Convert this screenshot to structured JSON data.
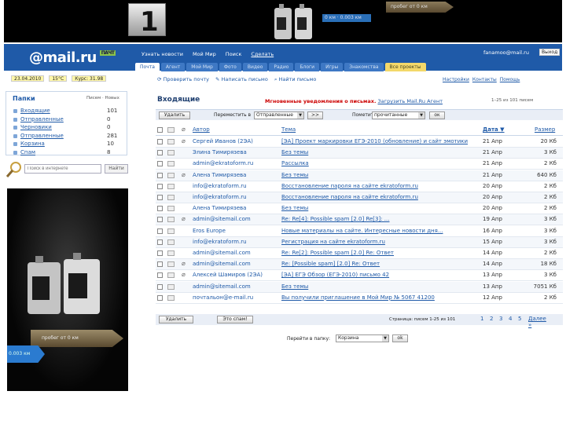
{
  "banner": {
    "badge_number": "1",
    "progress_short": "0 км · 0.003 км",
    "progress_long": "пробег от 0 км"
  },
  "header": {
    "logo": "@mail.ru",
    "logo_badge": "ПАЧТ",
    "nav": [
      "Узнать новости",
      "Мой Мир",
      "Поиск",
      "Сделать"
    ],
    "account": "fanamoo@mail.ru",
    "exit": "Выход"
  },
  "tabs": [
    "Почта",
    "Агент",
    "Мой Мир",
    "Фото",
    "Видео",
    "Радио",
    "Блоги",
    "Игры",
    "Знакомства",
    "Все проекты"
  ],
  "left": {
    "date_strip": [
      "23.04.2010",
      "15°C",
      "Курс: 31.98"
    ],
    "folders_title": "Папки",
    "folders_head": "Писем · Новых",
    "folders": [
      {
        "name": "Входящие",
        "count": "101"
      },
      {
        "name": "Отправленные",
        "count": "0"
      },
      {
        "name": "Черновики",
        "count": "0"
      },
      {
        "name": "Отправленные",
        "count": "281"
      },
      {
        "name": "Корзина",
        "count": "10"
      },
      {
        "name": "Спам",
        "count": "8"
      }
    ],
    "search_placeholder": "Поиск в интернете",
    "search_button": "Найти",
    "ad_bar1": "пробег от 0 км",
    "ad_bar2": "0.003 км"
  },
  "actions": {
    "check": "Проверить почту",
    "compose": "Написать письмо",
    "find": "Найти письмо"
  },
  "right_links": [
    "Настройки",
    "Контакты",
    "Помощь"
  ],
  "inbox_title": "Входящие",
  "im_notice": {
    "red": "Мгновенные уведомления о письмах.",
    "link": "Загрузить Mail.Ru Агент"
  },
  "top_right_small": "1–25 из 101 писем",
  "filters": {
    "delete": "Удалить",
    "move_to_label": "Переместить в",
    "move_select": "Отправленные",
    "go": ">>",
    "mark_label": "Пометить",
    "mark_select": "прочитанные",
    "ok": "ок"
  },
  "columns": {
    "author": "Автор",
    "subject": "Тема",
    "date": "Дата ▼",
    "size": "Размер"
  },
  "messages": [
    {
      "author": "Сергей Иванов (2ЭА)",
      "subject": "[ЭА] Проект маркировки ЕГЭ-2010 (обновление) и сайт эмотики",
      "date": "21 Апр",
      "size": "20 Кб",
      "clip": true
    },
    {
      "author": "Элина Тимирязева",
      "subject": "Без темы",
      "date": "21 Апр",
      "size": "3 Кб",
      "clip": false
    },
    {
      "author": "admin@ekratoform.ru",
      "subject": "Рассылка",
      "date": "21 Апр",
      "size": "2 Кб",
      "clip": false
    },
    {
      "author": "Алена Тимирязева",
      "subject": "Без темы",
      "date": "21 Апр",
      "size": "640 Кб",
      "clip": true
    },
    {
      "author": "info@ekratoform.ru",
      "subject": "Восстановление пароля на сайте ekratoform.ru",
      "date": "20 Апр",
      "size": "2 Кб",
      "clip": false
    },
    {
      "author": "info@ekratoform.ru",
      "subject": "Восстановление пароля на сайте ekratoform.ru",
      "date": "20 Апр",
      "size": "2 Кб",
      "clip": false
    },
    {
      "author": "Алена Тимирязева",
      "subject": "Без темы",
      "date": "20 Апр",
      "size": "2 Кб",
      "clip": false
    },
    {
      "author": "admin@sitemail.com",
      "subject": "Re: Re[4]: Possible spam [2.0] Re[3]: ...",
      "date": "19 Апр",
      "size": "3 Кб",
      "clip": true
    },
    {
      "author": "Eros Europe",
      "subject": "Новые материалы на сайте. Интересные новости дня...",
      "date": "16 Апр",
      "size": "3 Кб",
      "clip": false
    },
    {
      "author": "info@ekratoform.ru",
      "subject": "Регистрация на сайте ekratoform.ru",
      "date": "15 Апр",
      "size": "3 Кб",
      "clip": false
    },
    {
      "author": "admin@sitemail.com",
      "subject": "Re: Re[2]: Possible spam [2.0] Re: Ответ",
      "date": "14 Апр",
      "size": "2 Кб",
      "clip": false
    },
    {
      "author": "admin@sitemail.com",
      "subject": "Re: [Possible spam] [2.0] Re: Ответ",
      "date": "14 Апр",
      "size": "18 Кб",
      "clip": true
    },
    {
      "author": "Алексей Шамиров (2ЭА)",
      "subject": "[ЭА] ЕГЭ Обзор (ЕГЭ-2010) письмо 42",
      "date": "13 Апр",
      "size": "3 Кб",
      "clip": true
    },
    {
      "author": "admin@sitemail.com",
      "subject": "Без темы",
      "date": "13 Апр",
      "size": "7051 Кб",
      "clip": false
    },
    {
      "author": "почтальон@e-mail.ru",
      "subject": "Вы получили приглашение в Мой Мир № 5067 41200",
      "date": "12 Апр",
      "size": "2 Кб",
      "clip": false
    }
  ],
  "bottom": {
    "delete": "Удалить",
    "spam": "Это спам!",
    "pager_label": "Страница: писем 1-25 из 101",
    "pages": [
      "1",
      "2",
      "3",
      "4",
      "5"
    ],
    "next": "Далее »",
    "goto_label": "Перейти в папку:",
    "goto_select": "Корзина",
    "goto_btn": "ok"
  }
}
